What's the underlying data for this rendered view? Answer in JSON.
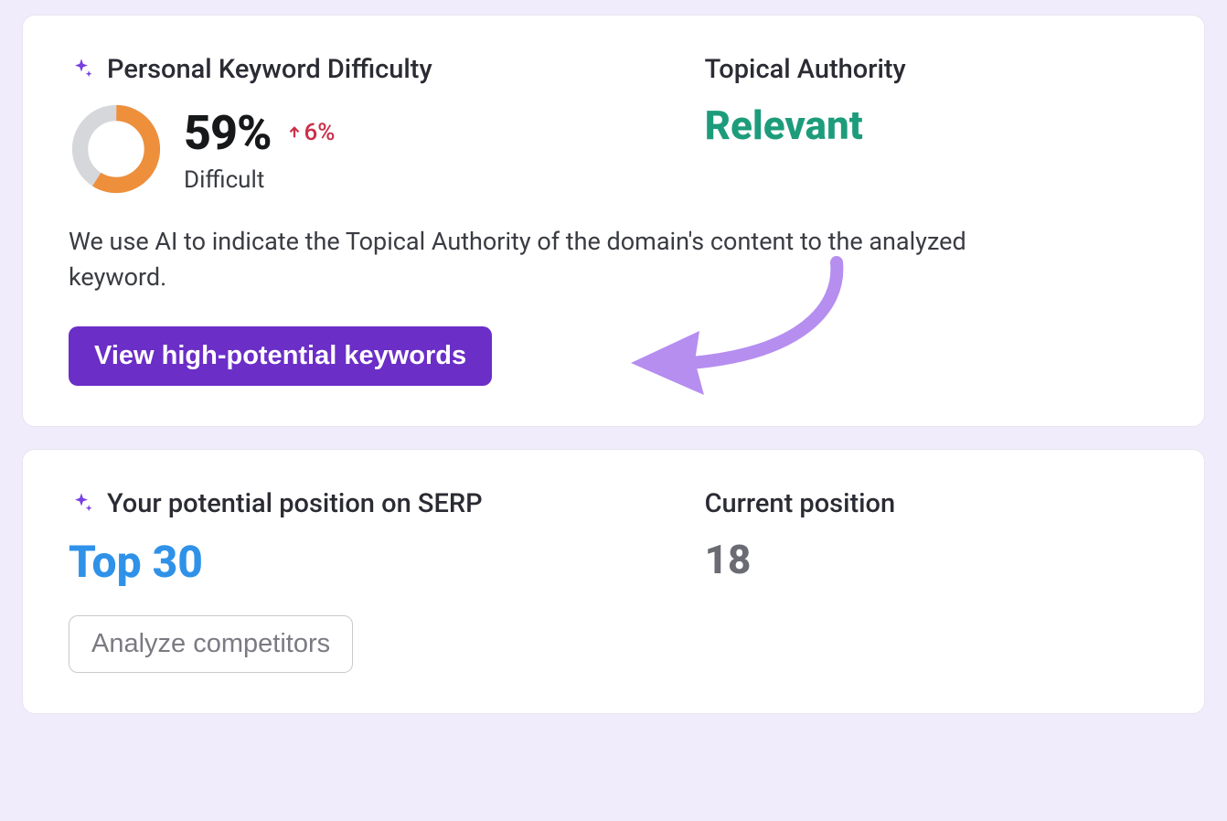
{
  "card1": {
    "pkd_title": "Personal Keyword Difficulty",
    "pkd_percent": "59%",
    "pkd_delta": "6%",
    "pkd_label": "Difficult",
    "pkd_donut_percent": 59,
    "ta_title": "Topical Authority",
    "ta_value": "Relevant",
    "description": "We use AI to indicate the Topical Authority of the domain's content to the analyzed keyword.",
    "cta_label": "View high-potential keywords"
  },
  "card2": {
    "potential_title": "Your potential position on SERP",
    "potential_value": "Top 30",
    "current_title": "Current position",
    "current_value": "18",
    "analyze_label": "Analyze competitors"
  },
  "colors": {
    "accent_purple": "#6b2ec7",
    "donut_fill": "#ee8f3c",
    "donut_track": "#d6d7db"
  }
}
